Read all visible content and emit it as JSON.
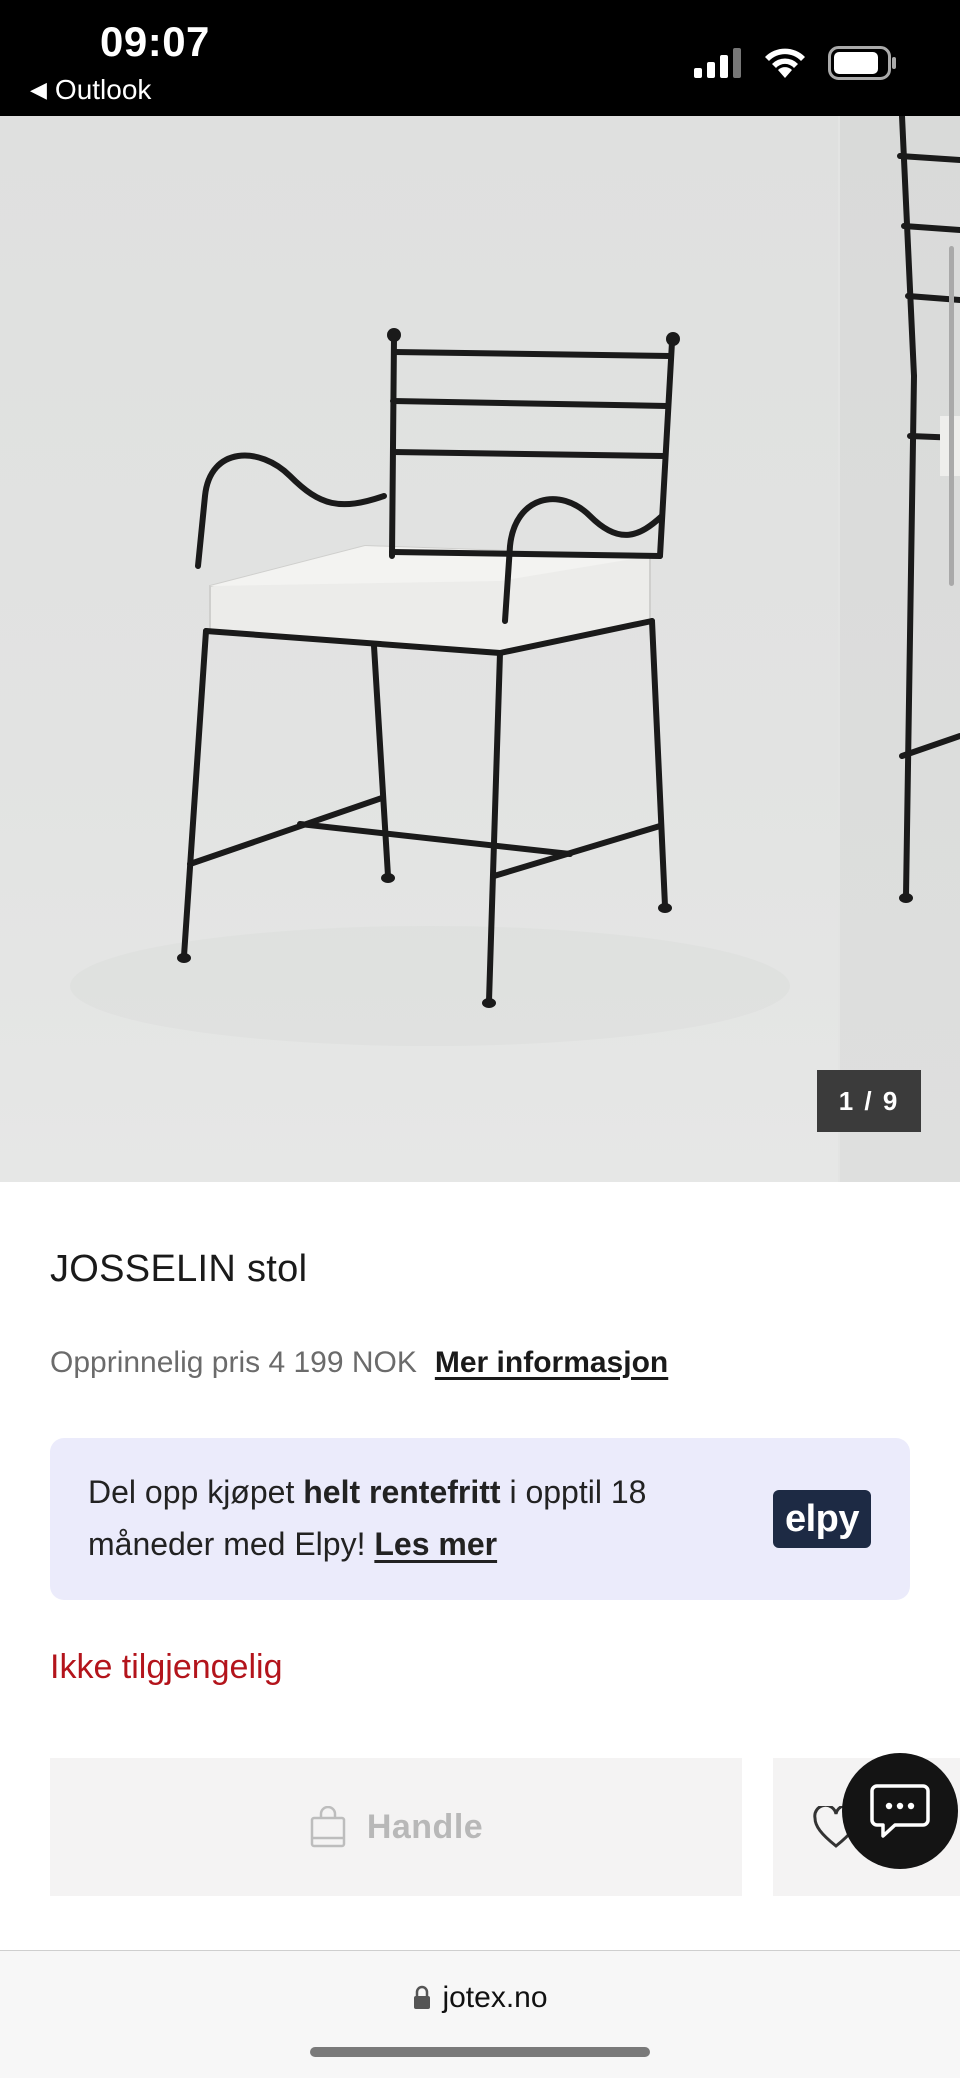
{
  "status_bar": {
    "time": "09:07",
    "back_label": "Outlook",
    "icons": [
      "cellular-signal-icon",
      "wifi-icon",
      "battery-icon"
    ]
  },
  "gallery": {
    "image_subject": "Black metal chair with wavy armrests and white seat cushion",
    "counter": "1 / 9"
  },
  "product": {
    "title": "JOSSELIN stol",
    "price_text": "Opprinnelig pris 4 199 NOK",
    "more_info_label": "Mer informasjon"
  },
  "elpy": {
    "text_before": "Del opp kjøpet ",
    "text_bold": "helt rentefritt",
    "text_after": " i opptil 18 måneder med Elpy! ",
    "link_label": "Les mer",
    "logo_text": "elpy",
    "background_color": "#ebebfb",
    "logo_color": "#1d2a44"
  },
  "availability": {
    "text": "Ikke tilgjengelig",
    "color": "#b3141b"
  },
  "actions": {
    "buy_label": "Handle",
    "wishlist_icon": "heart-icon",
    "chat_icon": "chat-bubble-icon"
  },
  "browser": {
    "url": "jotex.no",
    "lock_icon": "lock-icon"
  }
}
